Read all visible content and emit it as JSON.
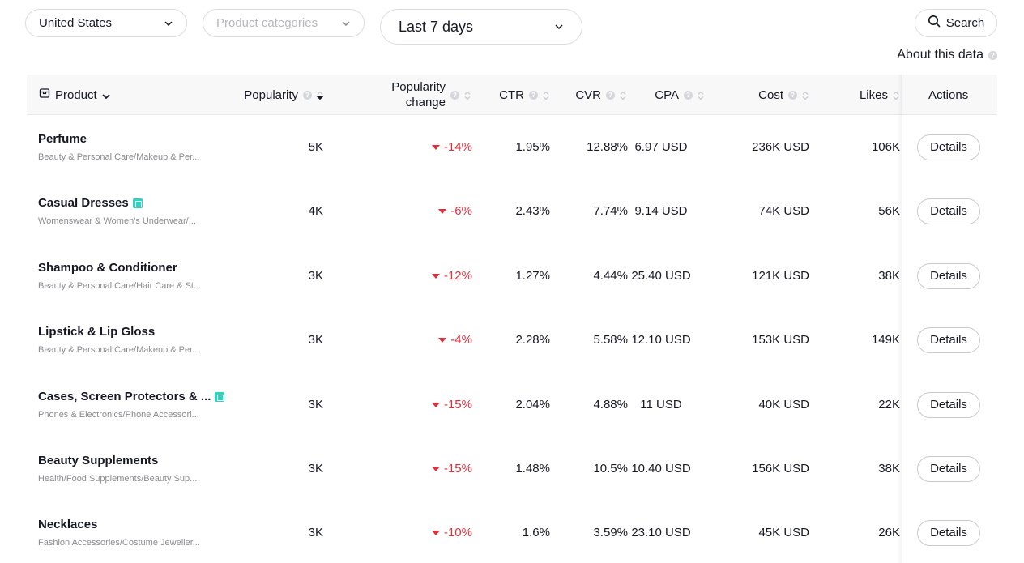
{
  "filters": {
    "country": "United States",
    "category_placeholder": "Product categories",
    "date_range": "Last 7 days"
  },
  "search": {
    "label": "Search"
  },
  "about": {
    "label": "About this data"
  },
  "table": {
    "headers": {
      "product": "Product",
      "popularity": "Popularity",
      "popularity_change_line1": "Popularity",
      "popularity_change_line2": "change",
      "ctr": "CTR",
      "cvr": "CVR",
      "cpa": "CPA",
      "cost": "Cost",
      "likes": "Likes",
      "actions": "Actions"
    },
    "rows": [
      {
        "name": "Perfume",
        "category": "Beauty & Personal Care/Makeup & Per...",
        "popularity": "5K",
        "change": "-14%",
        "ctr": "1.95%",
        "cvr": "12.88%",
        "cpa": "6.97 USD",
        "cost": "236K USD",
        "likes": "106K",
        "action": "Details"
      },
      {
        "name": "Casual Dresses",
        "category": "Womenswear & Women's Underwear/...",
        "popularity": "4K",
        "change": "-6%",
        "ctr": "2.43%",
        "cvr": "7.74%",
        "cpa": "9.14 USD",
        "cost": "74K USD",
        "likes": "56K",
        "action": "Details"
      },
      {
        "name": "Shampoo & Conditioner",
        "category": "Beauty & Personal Care/Hair Care & St...",
        "popularity": "3K",
        "change": "-12%",
        "ctr": "1.27%",
        "cvr": "4.44%",
        "cpa": "25.40 USD",
        "cost": "121K USD",
        "likes": "38K",
        "action": "Details"
      },
      {
        "name": "Lipstick & Lip Gloss",
        "category": "Beauty & Personal Care/Makeup & Per...",
        "popularity": "3K",
        "change": "-4%",
        "ctr": "2.28%",
        "cvr": "5.58%",
        "cpa": "12.10 USD",
        "cost": "153K USD",
        "likes": "149K",
        "action": "Details"
      },
      {
        "name": "Cases, Screen Protectors & ...",
        "category": "Phones & Electronics/Phone Accessori...",
        "popularity": "3K",
        "change": "-15%",
        "ctr": "2.04%",
        "cvr": "4.88%",
        "cpa": "11 USD",
        "cost": "40K USD",
        "likes": "22K",
        "action": "Details"
      },
      {
        "name": "Beauty Supplements",
        "category": "Health/Food Supplements/Beauty Sup...",
        "popularity": "3K",
        "change": "-15%",
        "ctr": "1.48%",
        "cvr": "10.5%",
        "cpa": "10.40 USD",
        "cost": "156K USD",
        "likes": "38K",
        "action": "Details"
      },
      {
        "name": "Necklaces",
        "category": "Fashion Accessories/Costume Jeweller...",
        "popularity": "3K",
        "change": "-10%",
        "ctr": "1.6%",
        "cvr": "3.59%",
        "cpa": "23.10 USD",
        "cost": "45K USD",
        "likes": "26K",
        "action": "Details"
      }
    ]
  },
  "colors": {
    "negative": "#e02f3d",
    "badge": "#2dd4bf",
    "header_bg": "#f8f8f8"
  }
}
